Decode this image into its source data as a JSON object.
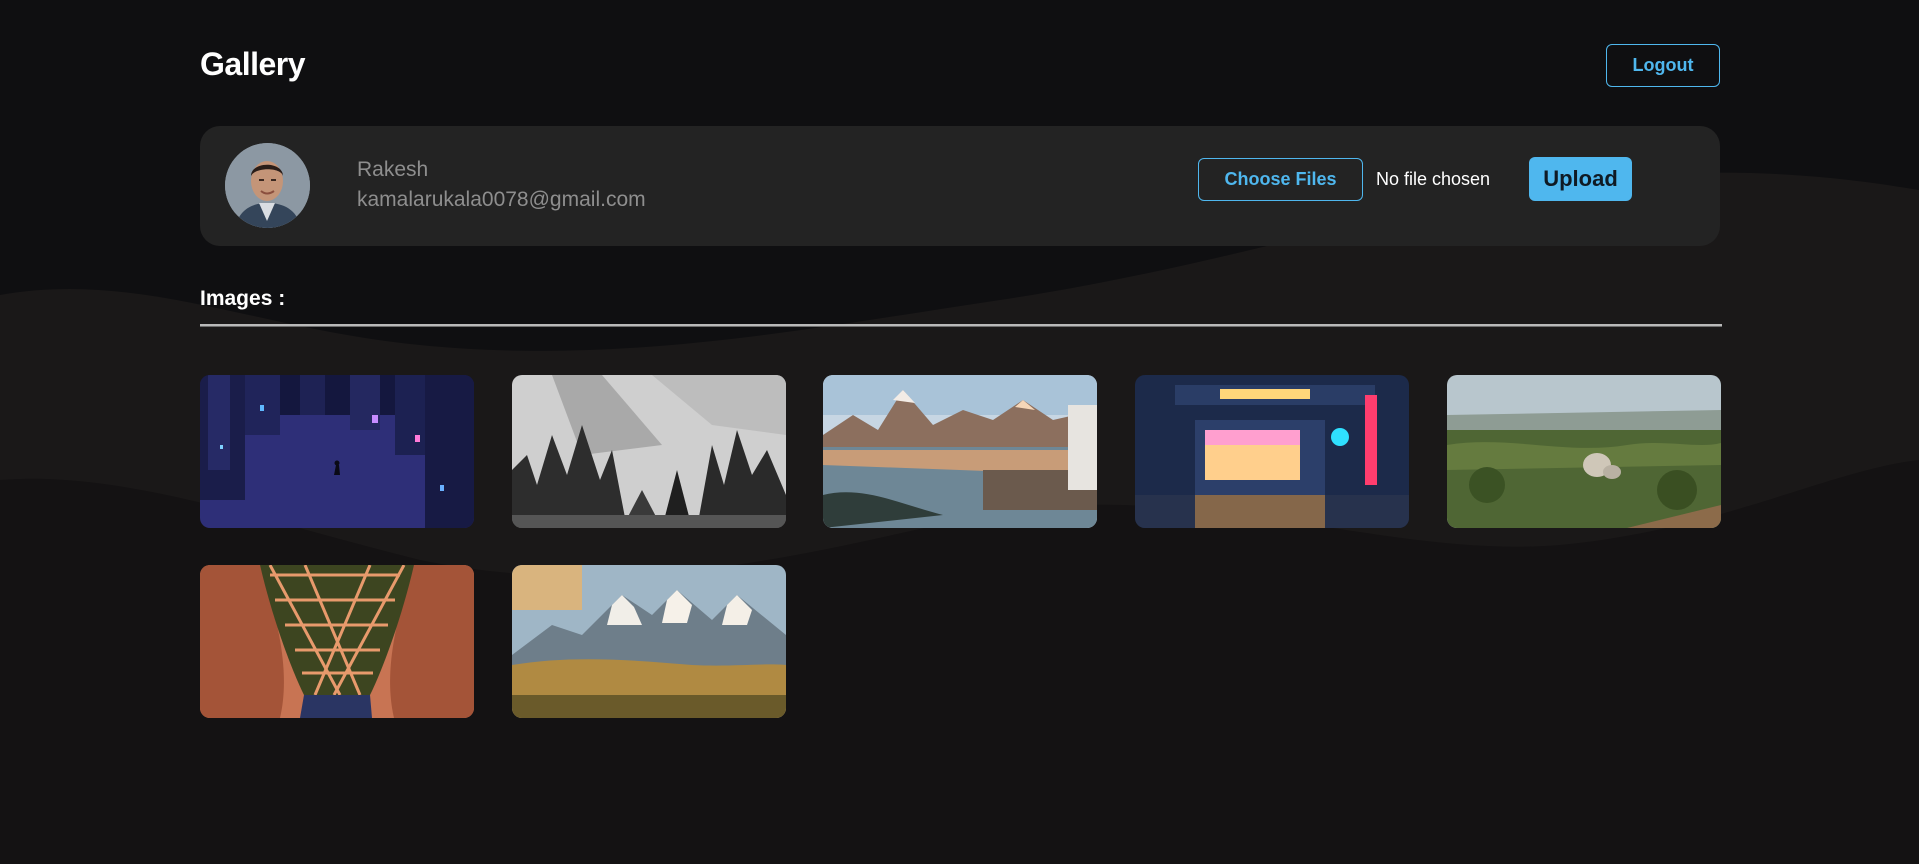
{
  "header": {
    "title": "Gallery",
    "logout_label": "Logout"
  },
  "profile": {
    "name": "Rakesh",
    "email": "kamalarukala0078@gmail.com",
    "choose_files_label": "Choose Files",
    "file_status": "No file chosen",
    "upload_label": "Upload"
  },
  "images_section": {
    "heading": "Images :"
  },
  "gallery": [
    {
      "subject": "inverted-city-night"
    },
    {
      "subject": "black-and-white-forest"
    },
    {
      "subject": "mountain-lake-pier"
    },
    {
      "subject": "coffee-shop-night"
    },
    {
      "subject": "green-hills-landscape"
    },
    {
      "subject": "orange-lattice-architecture"
    },
    {
      "subject": "snowy-mountain-range"
    }
  ],
  "colors": {
    "accent": "#4fb7ee",
    "background": "#0f0f11",
    "card": "#232323",
    "muted_text": "#8e8e8e"
  }
}
